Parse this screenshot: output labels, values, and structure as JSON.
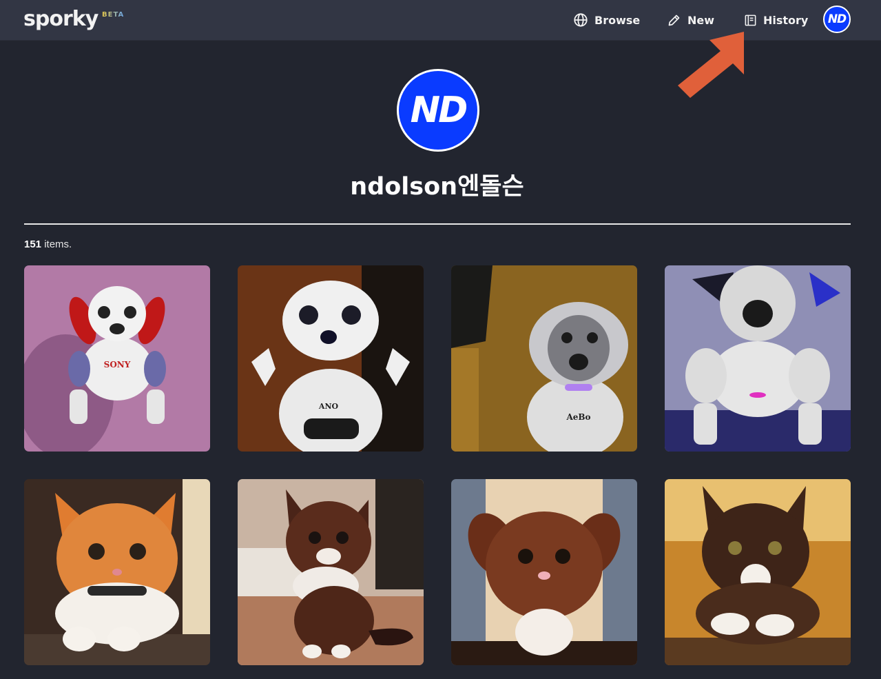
{
  "header": {
    "logo": "sporky",
    "beta": "BETA",
    "nav": [
      {
        "label": "Browse",
        "icon": "globe-icon"
      },
      {
        "label": "New",
        "icon": "pencil-icon"
      },
      {
        "label": "History",
        "icon": "history-icon"
      }
    ],
    "avatar_initials": "ND"
  },
  "profile": {
    "avatar_initials": "ND",
    "username": "ndolson엔돌슨"
  },
  "gallery": {
    "count": "151",
    "count_suffix": "items.",
    "items": [
      {
        "subject": "robot dog",
        "label": "SONY",
        "bg": "#b27aa6"
      },
      {
        "subject": "robot dog",
        "label": "ANO",
        "bg": "#6a3416"
      },
      {
        "subject": "robot dog",
        "label": "AeBo",
        "bg": "#8a6420"
      },
      {
        "subject": "robot dog",
        "label": "",
        "bg": "#8f8fb5"
      },
      {
        "subject": "kitten",
        "fur": "#e0863c",
        "bg": "#3a2a22"
      },
      {
        "subject": "kitten",
        "fur": "#5a2c1c",
        "bg": "#c9b4a3"
      },
      {
        "subject": "kitten",
        "fur": "#7a3a20",
        "bg": "#6d7a8e"
      },
      {
        "subject": "kitten",
        "fur": "#3e2418",
        "bg": "#c8862c"
      }
    ]
  },
  "colors": {
    "background": "#22252f",
    "topbar": "#323644",
    "avatar": "#0a3bff",
    "arrow": "#e0603a"
  }
}
